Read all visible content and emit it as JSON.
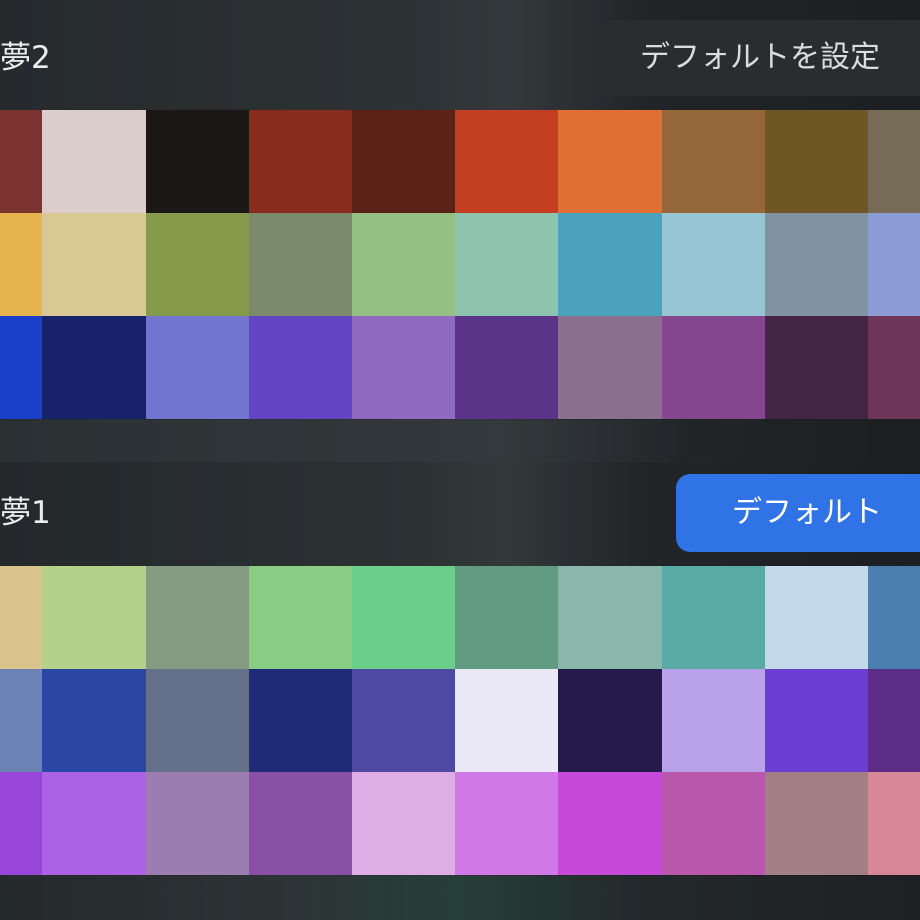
{
  "palettes": [
    {
      "name": "夢2",
      "button_label": "デフォルトを設定",
      "is_default": false,
      "rows": [
        [
          "#7b3330",
          "#dacdcc",
          "#1c1717",
          "#8a2c1d",
          "#5c2218",
          "#c43e22",
          "#e06f34",
          "#956639",
          "#6f5725",
          "#766b55"
        ],
        [
          "#e5b44c",
          "#d9c893",
          "#869a4b",
          "#7b8a6b",
          "#94c083",
          "#8ec4ae",
          "#4ba2bd",
          "#98c5d4",
          "#7f94a0",
          "#8c9dd6"
        ],
        [
          "#1a3fc8",
          "#17226a",
          "#7274d0",
          "#6344c3",
          "#9069c1",
          "#5b3387",
          "#8b6f8e",
          "#84478f",
          "#432544",
          "#6d3558"
        ]
      ]
    },
    {
      "name": "夢1",
      "button_label": "デフォルト",
      "is_default": true,
      "rows": [
        [
          "#dac48e",
          "#b4d08a",
          "#859c82",
          "#89cd85",
          "#6bcf8b",
          "#619b82",
          "#8ab6ab",
          "#5aaaa5",
          "#c3d9ea",
          "#4b7fb0"
        ],
        [
          "#6c82b5",
          "#2c47a3",
          "#647089",
          "#1f2b79",
          "#4e4aa2",
          "#eae8f6",
          "#241a4b",
          "#b9a2e9",
          "#6a3ed0",
          "#5b2d87"
        ],
        [
          "#9746d9",
          "#ad62e5",
          "#9b7db1",
          "#8850a6",
          "#dfade5",
          "#d079e6",
          "#c64ad9",
          "#b957ad",
          "#a27f85",
          "#d68897"
        ]
      ]
    }
  ]
}
